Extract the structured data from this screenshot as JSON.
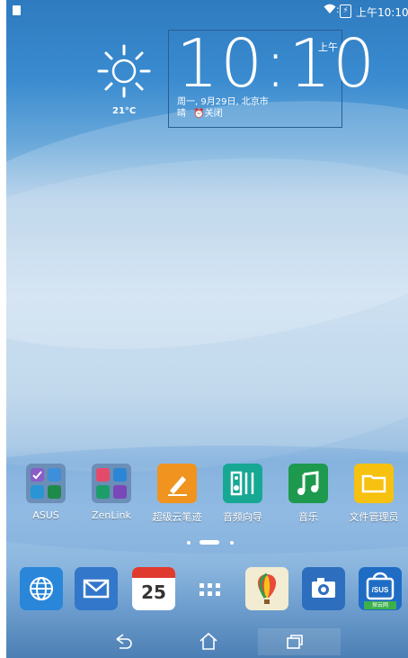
{
  "status_bar": {
    "time": "上午10:10",
    "wifi_icon": "wifi-icon",
    "battery_icon": "battery-charging-icon"
  },
  "weather": {
    "temperature": "21°C",
    "icon": "sun-icon"
  },
  "clock": {
    "time": "10:10",
    "ampm": "上午",
    "date_location": "周一, 9月29日, 北京市",
    "status": "晴",
    "alarm": "⏰关闭"
  },
  "apps": [
    {
      "label": "ASUS",
      "type": "folder"
    },
    {
      "label": "ZenLink",
      "type": "folder"
    },
    {
      "label": "超级云笔迹",
      "icon": "pencil-icon",
      "color": "#f0931f"
    },
    {
      "label": "音频向导",
      "icon": "equalizer-icon",
      "color": "#17a893"
    },
    {
      "label": "音乐",
      "icon": "music-note-icon",
      "color": "#1e9a4e"
    },
    {
      "label": "文件管理员",
      "icon": "folder-icon",
      "color": "#f6c10f"
    }
  ],
  "dock": [
    {
      "name": "browser",
      "icon": "globe-icon",
      "color": "#2a86d9"
    },
    {
      "name": "email",
      "icon": "mail-icon",
      "color": "#3277c9"
    },
    {
      "name": "calendar",
      "icon": "calendar-icon",
      "value": "25"
    },
    {
      "name": "all-apps",
      "icon": "app-grid-icon"
    },
    {
      "name": "maps",
      "icon": "balloon-icon"
    },
    {
      "name": "camera",
      "icon": "camera-icon",
      "color": "#2d6fbe"
    },
    {
      "name": "store",
      "icon": "asus-store-icon",
      "label": "探云网"
    }
  ],
  "page_indicator": {
    "pages": 3,
    "current": 2
  },
  "nav": {
    "back_icon": "back-icon",
    "home_icon": "home-icon",
    "recents_icon": "recents-icon"
  }
}
